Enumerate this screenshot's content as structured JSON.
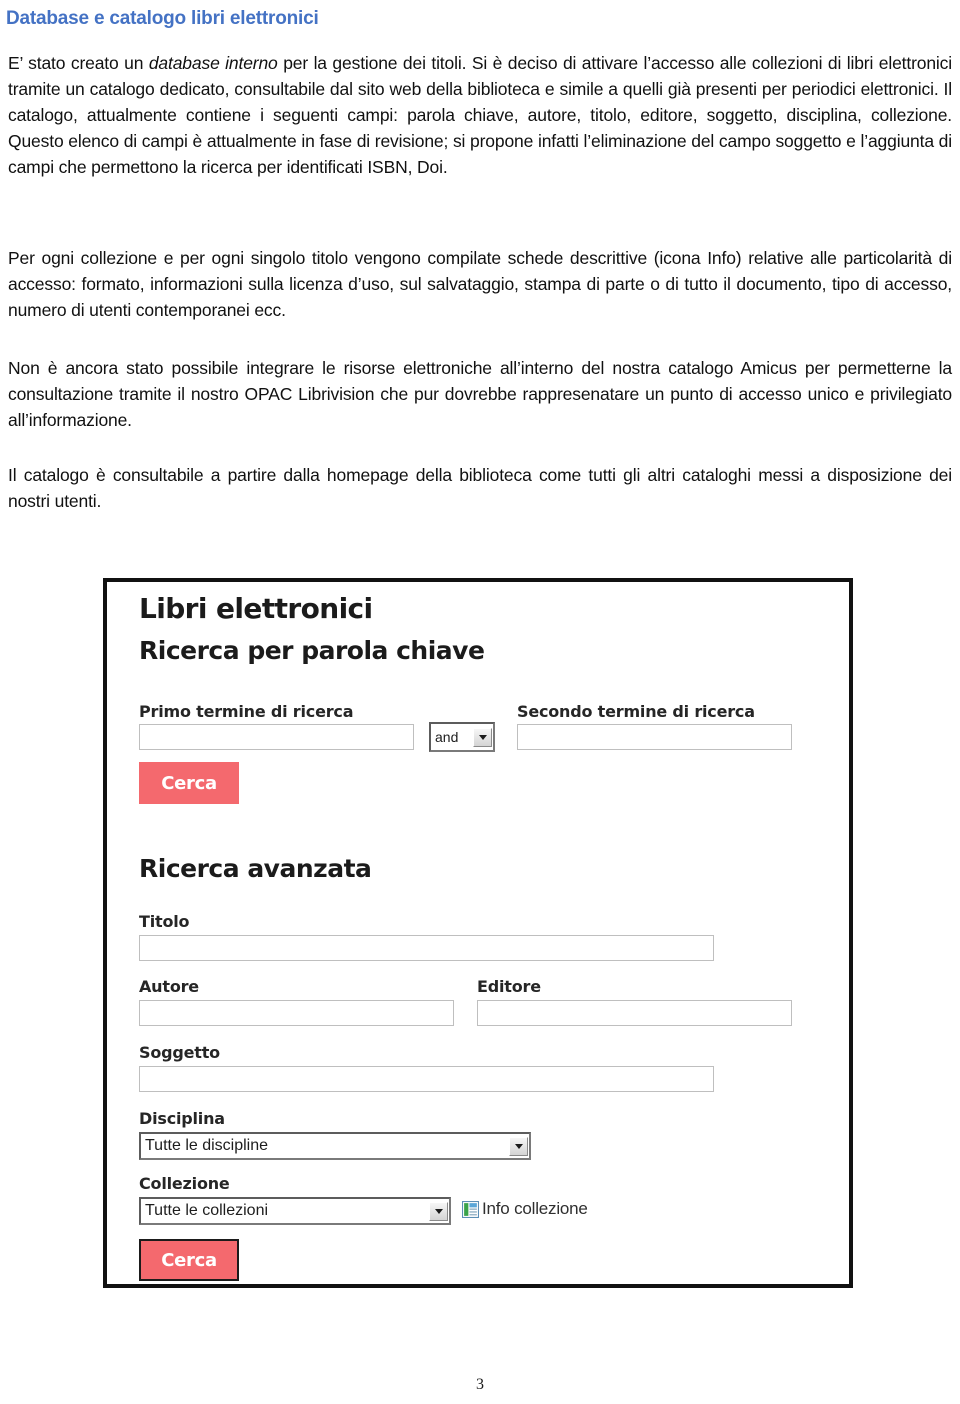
{
  "document": {
    "title": "Database  e catalogo libri elettronici",
    "title_color": "#4472C4",
    "page_number": "3",
    "paragraphs": {
      "p1_part1": "E’ stato creato un ",
      "p1_italic": "database interno",
      "p1_part2": " per la gestione dei titoli. Si è deciso di attivare l’accesso alle collezioni di libri elettronici tramite un catalogo dedicato, consultabile dal sito web della biblioteca e simile a quelli già presenti per periodici elettronici. Il catalogo, attualmente contiene i seguenti campi: parola chiave, autore, titolo, editore, soggetto, disciplina, collezione. Questo elenco di campi è attualmente in fase di revisione; si propone infatti l’eliminazione del campo soggetto  e l’aggiunta di campi che permettono la ricerca per identificati ISBN, Doi.",
      "p2": "Per ogni collezione e per ogni singolo titolo vengono compilate schede descrittive (icona Info) relative alle particolarità di accesso: formato, informazioni sulla licenza d’uso, sul salvataggio, stampa di parte o di tutto il documento, tipo di accesso, numero di utenti contemporanei ecc.",
      "p3": "Non è ancora stato possibile integrare le risorse elettroniche all’interno del nostra catalogo Amicus per permetterne la consultazione tramite il nostro OPAC Librivision che pur dovrebbe rappresenatare un punto di accesso unico e privilegiato all’informazione.",
      "p4": "Il catalogo è consultabile a partire dalla homepage della biblioteca come tutti gli altri cataloghi messi a disposizione dei nostri utenti."
    }
  },
  "screenshot": {
    "heading": "Libri elettronici",
    "keyword_search": {
      "heading": "Ricerca per parola chiave",
      "first_term_label": "Primo termine di ricerca",
      "first_term_value": "",
      "operator_value": "and",
      "second_term_label": "Secondo termine di ricerca",
      "second_term_value": "",
      "search_button": "Cerca"
    },
    "advanced_search": {
      "heading": "Ricerca avanzata",
      "title_label": "Titolo",
      "title_value": "",
      "author_label": "Autore",
      "author_value": "",
      "publisher_label": "Editore",
      "publisher_value": "",
      "subject_label": "Soggetto",
      "subject_value": "",
      "discipline_label": "Disciplina",
      "discipline_value": "Tutte le discipline",
      "collection_label": "Collezione",
      "collection_value": "Tutte le collezioni",
      "info_link_label": "Info collezione",
      "info_icon": "info-document-icon",
      "search_button": "Cerca"
    },
    "colors": {
      "button_fill": "#F4696E",
      "button_text": "#FFFFFF",
      "frame_border": "#111111"
    }
  }
}
